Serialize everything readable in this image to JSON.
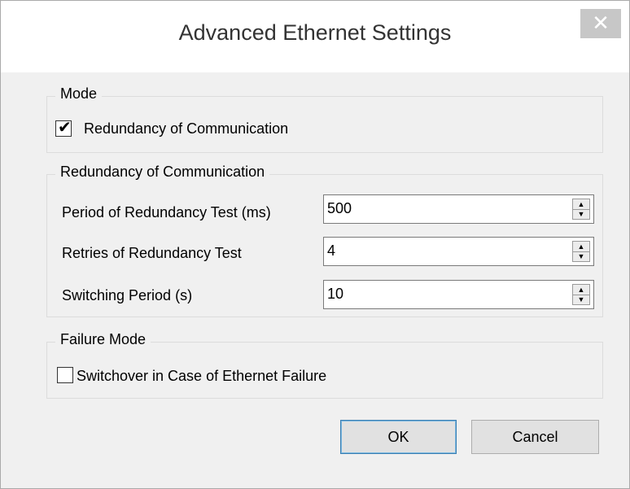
{
  "window": {
    "title": "Advanced Ethernet Settings",
    "close_glyph": "✕"
  },
  "mode": {
    "legend": "Mode",
    "redundancy_checkbox": {
      "label": "Redundancy of Communication",
      "checked": true
    }
  },
  "redundancy": {
    "legend": "Redundancy of Communication",
    "fields": [
      {
        "label": "Period of Redundancy Test (ms)",
        "value": "500"
      },
      {
        "label": "Retries of Redundancy Test",
        "value": "4"
      },
      {
        "label": "Switching Period (s)",
        "value": "10"
      }
    ]
  },
  "failure_mode": {
    "legend": "Failure Mode",
    "switchover_checkbox": {
      "label": "Switchover in Case of Ethernet Failure",
      "checked": false
    }
  },
  "buttons": {
    "ok": "OK",
    "cancel": "Cancel"
  },
  "icons": {
    "spin_up": "▲",
    "spin_down": "▼",
    "checkmark": "✔"
  },
  "colors": {
    "dialog_background": "#f0f0f0",
    "title_background": "#ffffff",
    "close_button_background": "#c7c7c7",
    "default_button_border": "#3c7fb1"
  }
}
